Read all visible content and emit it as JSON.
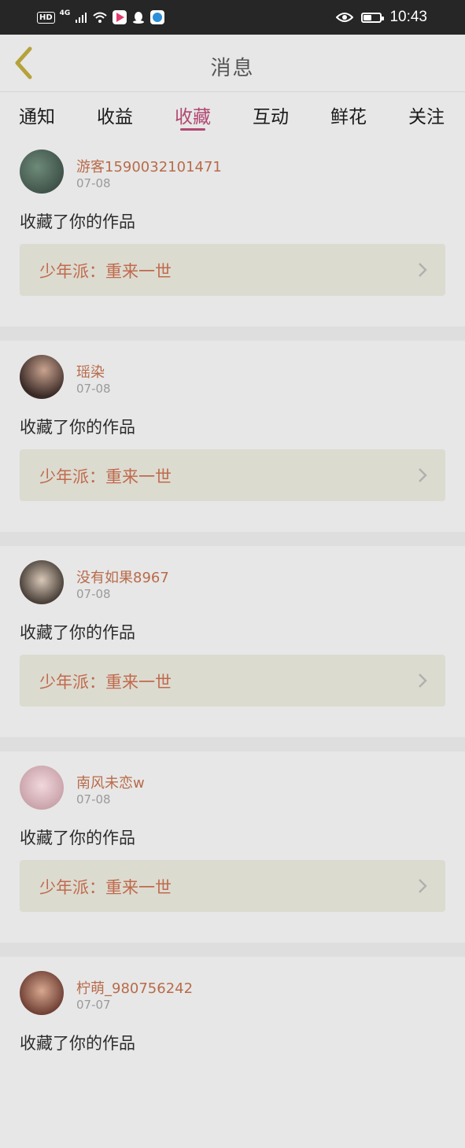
{
  "status_bar": {
    "network": "4G",
    "hd": "HD",
    "time": "10:43",
    "battery_level": 0.5
  },
  "header": {
    "title": "消息"
  },
  "tabs": [
    {
      "label": "通知",
      "active": false
    },
    {
      "label": "收益",
      "active": false
    },
    {
      "label": "收藏",
      "active": true
    },
    {
      "label": "互动",
      "active": false
    },
    {
      "label": "鲜花",
      "active": false
    },
    {
      "label": "关注",
      "active": false
    }
  ],
  "items": [
    {
      "username": "游客1590032101471",
      "date": "07-08",
      "action": "收藏了你的作品",
      "work_title": "少年派：重来一世"
    },
    {
      "username": "瑶染",
      "date": "07-08",
      "action": "收藏了你的作品",
      "work_title": "少年派：重来一世"
    },
    {
      "username": "没有如果8967",
      "date": "07-08",
      "action": "收藏了你的作品",
      "work_title": "少年派：重来一世"
    },
    {
      "username": "南风未恋w",
      "date": "07-08",
      "action": "收藏了你的作品",
      "work_title": "少年派：重来一世"
    },
    {
      "username": "柠萌_980756242",
      "date": "07-07",
      "action": "收藏了你的作品",
      "work_title": "少年派：重来一世"
    }
  ],
  "colors": {
    "accent": "#b14872",
    "username": "#b86b4a",
    "work_title": "#c06a4d",
    "back_icon": "#b5a23a"
  }
}
